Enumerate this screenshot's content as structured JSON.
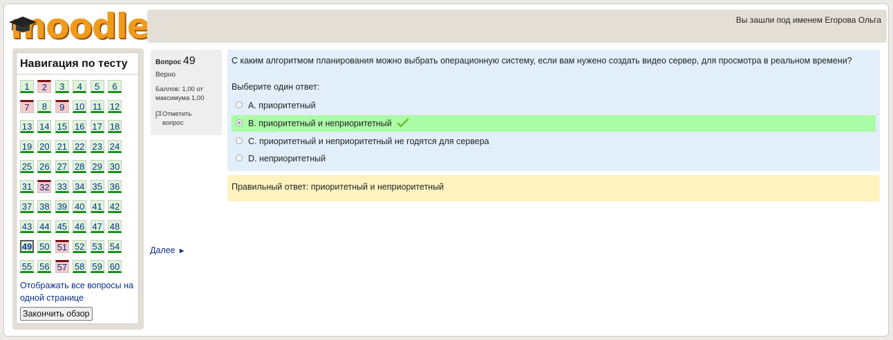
{
  "header": {
    "logo_text": "moodle",
    "user_text": "Вы зашли под именем Егорова Ольга"
  },
  "nav": {
    "title": "Навигация по тесту",
    "questions": [
      {
        "n": "1",
        "s": "correct"
      },
      {
        "n": "2",
        "s": "wrong"
      },
      {
        "n": "3",
        "s": "correct"
      },
      {
        "n": "4",
        "s": "correct"
      },
      {
        "n": "5",
        "s": "correct"
      },
      {
        "n": "6",
        "s": "correct"
      },
      {
        "n": "7",
        "s": "wrong"
      },
      {
        "n": "8",
        "s": "correct"
      },
      {
        "n": "9",
        "s": "wrong"
      },
      {
        "n": "10",
        "s": "correct"
      },
      {
        "n": "11",
        "s": "correct"
      },
      {
        "n": "12",
        "s": "correct"
      },
      {
        "n": "13",
        "s": "correct"
      },
      {
        "n": "14",
        "s": "correct"
      },
      {
        "n": "15",
        "s": "correct"
      },
      {
        "n": "16",
        "s": "correct"
      },
      {
        "n": "17",
        "s": "correct"
      },
      {
        "n": "18",
        "s": "correct"
      },
      {
        "n": "19",
        "s": "correct"
      },
      {
        "n": "20",
        "s": "correct"
      },
      {
        "n": "21",
        "s": "correct"
      },
      {
        "n": "22",
        "s": "correct"
      },
      {
        "n": "23",
        "s": "correct"
      },
      {
        "n": "24",
        "s": "correct"
      },
      {
        "n": "25",
        "s": "correct"
      },
      {
        "n": "26",
        "s": "correct"
      },
      {
        "n": "27",
        "s": "correct"
      },
      {
        "n": "28",
        "s": "correct"
      },
      {
        "n": "29",
        "s": "correct"
      },
      {
        "n": "30",
        "s": "correct"
      },
      {
        "n": "31",
        "s": "correct"
      },
      {
        "n": "32",
        "s": "wrong"
      },
      {
        "n": "33",
        "s": "correct"
      },
      {
        "n": "34",
        "s": "correct"
      },
      {
        "n": "35",
        "s": "correct"
      },
      {
        "n": "36",
        "s": "correct"
      },
      {
        "n": "37",
        "s": "correct"
      },
      {
        "n": "38",
        "s": "correct"
      },
      {
        "n": "39",
        "s": "correct"
      },
      {
        "n": "40",
        "s": "correct"
      },
      {
        "n": "41",
        "s": "correct"
      },
      {
        "n": "42",
        "s": "correct"
      },
      {
        "n": "43",
        "s": "correct"
      },
      {
        "n": "44",
        "s": "correct"
      },
      {
        "n": "45",
        "s": "correct"
      },
      {
        "n": "46",
        "s": "correct"
      },
      {
        "n": "47",
        "s": "correct"
      },
      {
        "n": "48",
        "s": "correct"
      },
      {
        "n": "49",
        "s": "current"
      },
      {
        "n": "50",
        "s": "correct"
      },
      {
        "n": "51",
        "s": "wrong"
      },
      {
        "n": "52",
        "s": "correct"
      },
      {
        "n": "53",
        "s": "correct"
      },
      {
        "n": "54",
        "s": "correct"
      },
      {
        "n": "55",
        "s": "correct"
      },
      {
        "n": "56",
        "s": "correct"
      },
      {
        "n": "57",
        "s": "wrong"
      },
      {
        "n": "58",
        "s": "correct"
      },
      {
        "n": "59",
        "s": "correct"
      },
      {
        "n": "60",
        "s": "correct"
      }
    ],
    "show_all_link": "Отображать все вопросы на одной странице",
    "finish_button": "Закончить обзор"
  },
  "question": {
    "label": "Вопрос",
    "number": "49",
    "state": "Верно",
    "grade": "Баллов: 1,00 от максимума 1,00",
    "flag_label": "Отметить вопрос",
    "text": "С каким алгоритмом планирования можно выбрать операционную систему, если вам нужено создать видео сервер, для просмотра в реальном времени?",
    "prompt": "Выберите один ответ:",
    "answers": [
      {
        "label": "A. приоритетный",
        "selected": false
      },
      {
        "label": "B. приоритетный и неприоритетный",
        "selected": true
      },
      {
        "label": "C. приоритетный и неприоритетный не годятся для сервера",
        "selected": false
      },
      {
        "label": "D. неприоритетный",
        "selected": false
      }
    ],
    "feedback": "Правильный ответ: приоритетный и неприоритетный"
  },
  "next_link": "Далее",
  "colors": {
    "correct_fill": "#ddf6d6",
    "wrong_fill": "#f6c9c9",
    "selected_answer": "#aafca6",
    "question_bg": "#e2eef9",
    "feedback_bg": "#fef3bf",
    "logo_orange": "#f09a1c"
  },
  "icons": {
    "flag": "flag-icon",
    "check": "checkmark-icon",
    "next": "triangle-right-icon",
    "logo_cap": "graduation-cap-icon"
  }
}
